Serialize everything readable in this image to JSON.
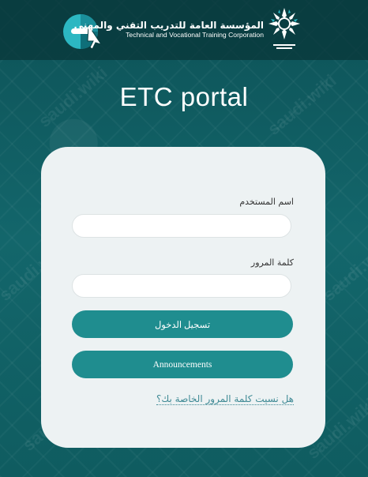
{
  "header": {
    "org_name_ar": "المؤسسة العامة للتدريب التقني والمهني",
    "org_name_en": "Technical and Vocational Training Corporation",
    "etc_logo_icon": "etc-e-cursor-logo",
    "emblem_icon": "tvtc-palm-emblem"
  },
  "page": {
    "title": "ETC portal"
  },
  "login": {
    "username_label": "اسم المستخدم",
    "username_value": "",
    "password_label": "كلمة المرور",
    "password_value": "",
    "login_button": "تسجيل الدخول",
    "announcements_button": "Announcements",
    "forgot_password_link": "هل نسيت كلمة المرور الخاصة بك؟"
  },
  "watermark": {
    "text": "saudi.wiki"
  },
  "colors": {
    "background": "#0f5a5f",
    "header": "#0a3d40",
    "card": "#edf2f3",
    "button": "#1f8d8f",
    "link": "#3f8a95"
  }
}
